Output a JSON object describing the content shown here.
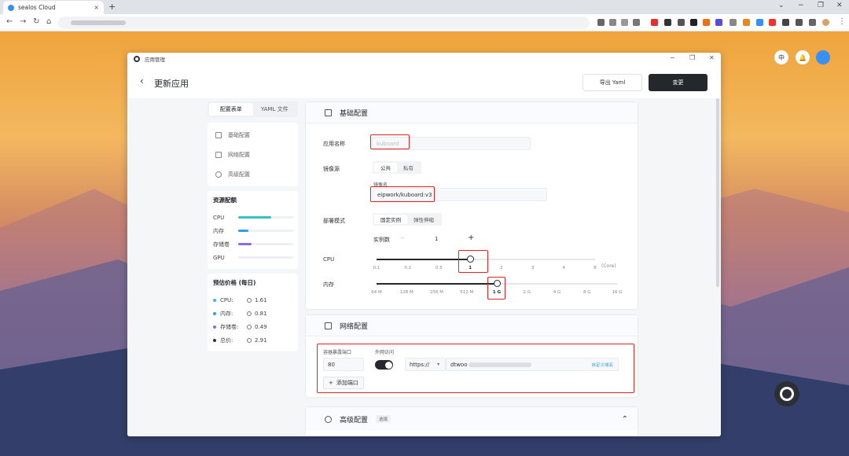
{
  "browser": {
    "tab_title": "sealos Cloud",
    "tab_close": "×",
    "new_tab": "+",
    "win_min": "⌄",
    "win_minimize": "−",
    "win_restore": "❐",
    "win_close": "✕"
  },
  "desktop": {
    "lang_button": "中",
    "bell_icon": "🔔"
  },
  "window": {
    "app_name": "应用管理",
    "back": "‹",
    "page_title": "更新应用",
    "export_yaml": "导出 Yaml",
    "change": "变更"
  },
  "left": {
    "tabs": [
      "配置表单",
      "YAML 文件"
    ],
    "nav": [
      "基础配置",
      "网络配置",
      "高级配置"
    ],
    "resources_title": "资源配额",
    "resources": [
      {
        "label": "CPU",
        "fraction": 0.6,
        "color": "#36c2bf"
      },
      {
        "label": "内存",
        "fraction": 0.18,
        "color": "#2f9ee8"
      },
      {
        "label": "存储卷",
        "fraction": 0.24,
        "color": "#8a6be0"
      },
      {
        "label": "GPU",
        "fraction": 0,
        "color": "#cccccc"
      }
    ],
    "price_title": "预估价格 (每日)",
    "prices": [
      {
        "label": "CPU:",
        "value": "1.61",
        "color": "#36c2bf"
      },
      {
        "label": "内存:",
        "value": "0.81",
        "color": "#2f9ee8"
      },
      {
        "label": "存储卷:",
        "value": "0.49",
        "color": "#8a6be0"
      },
      {
        "label": "总价:",
        "value": "2.91",
        "color": "#333333"
      }
    ]
  },
  "basic": {
    "title": "基础配置",
    "app_name_label": "应用名称",
    "app_name_value": "kuboard",
    "image_source_label": "镜像源",
    "image_source_options": [
      "公共",
      "私有"
    ],
    "image_name_label": "镜像名",
    "image_name_value": "eipwork/kuboard:v3",
    "deploy_mode_label": "部署模式",
    "deploy_mode_options": [
      "固定实例",
      "弹性伸缩"
    ],
    "replicas_label": "实例数",
    "replicas_minus": "−",
    "replicas_value": "1",
    "replicas_plus": "+",
    "cpu_label": "CPU",
    "cpu_ticks": [
      "0.1",
      "0.2",
      "0.5",
      "1",
      "2",
      "3",
      "4",
      "8"
    ],
    "cpu_unit": "(Core)",
    "cpu_selected_index": 3,
    "memory_label": "内存",
    "memory_ticks": [
      "64 M",
      "128 M",
      "256 M",
      "512 M",
      "1 G",
      "2 G",
      "4 G",
      "8 G",
      "16 G"
    ],
    "memory_selected_index": 4
  },
  "network": {
    "title": "网络配置",
    "port_label": "容器暴露端口",
    "port_value": "80",
    "public_label": "外网访问",
    "protocol": "https://",
    "domain": "dtwoo",
    "custom_domain": "自定义域名",
    "add_port": "添加端口"
  },
  "advanced": {
    "title": "高级配置",
    "badge": "选填",
    "chevron": "⌃"
  }
}
